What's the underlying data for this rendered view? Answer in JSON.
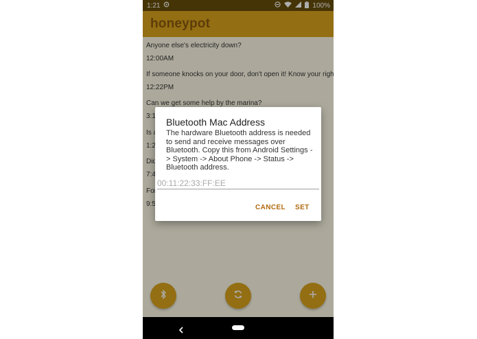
{
  "status_bar": {
    "time": "1:21",
    "battery": "100%",
    "icons": [
      "sync-icon",
      "dnd-icon",
      "wifi-icon",
      "signal-icon",
      "battery-icon"
    ]
  },
  "app_bar": {
    "title": "honeypot"
  },
  "messages": [
    {
      "text": "Anyone else's electricity down?",
      "time": "12:00AM"
    },
    {
      "text": "If someone knocks on your door, don't open it! Know your rights!",
      "time": "12:22PM"
    },
    {
      "text": "Can we get some help by the marina?",
      "time": "3:1"
    },
    {
      "text": "Is a",
      "time": "1:2"
    },
    {
      "text": "Did",
      "time": "7:4"
    },
    {
      "text": "For",
      "time": "9:5"
    }
  ],
  "fabs": {
    "bluetooth": "bluetooth-icon",
    "refresh": "refresh-icon",
    "add": "plus-icon"
  },
  "dialog": {
    "title": "Bluetooth Mac Address",
    "body": "The hardware Bluetooth address is needed to send and receive messages over Bluetooth. Copy this from Android Settings -> System -> About Phone -> Status -> Bluetooth address.",
    "input_placeholder": "00:11:22:33:FF:EE",
    "input_value": "",
    "cancel_label": "CANCEL",
    "set_label": "SET"
  },
  "nav_bar": {
    "icons": [
      "back-icon",
      "home-pill-icon"
    ]
  },
  "colors": {
    "primary": "#d9a21d",
    "primary_dark": "#664d0a",
    "title_text": "#8a5a0e",
    "accent_button": "#b26a0e"
  }
}
